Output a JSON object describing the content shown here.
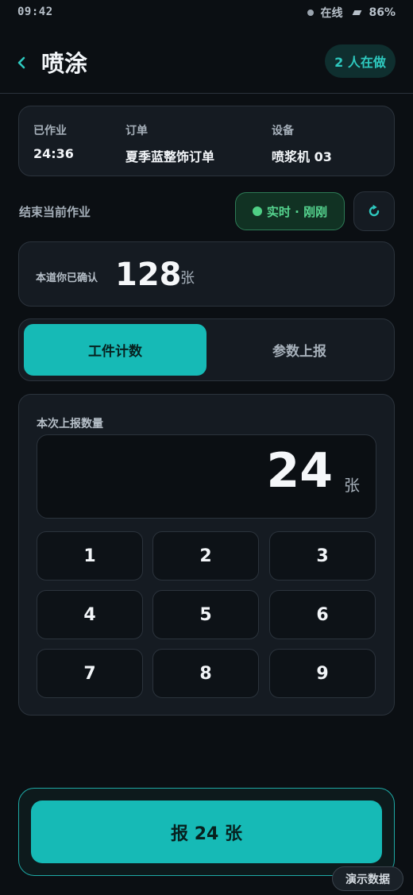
{
  "status_bar": {
    "time": "09:42",
    "network": "在线",
    "battery": "86%"
  },
  "header": {
    "title": "喷涂",
    "online_badge": "2 人在做"
  },
  "info": {
    "elapsed_label": "已作业",
    "elapsed_value": "24:36",
    "order_label": "订单",
    "order_value": "夏季蓝整饰订单",
    "device_label": "设备",
    "device_value": "喷浆机 03"
  },
  "actions": {
    "end_label": "结束当前作业",
    "live_label": "实时 · 刚刚"
  },
  "confirmed": {
    "label": "本道你已确认",
    "value": "128",
    "unit": "张"
  },
  "tabs": [
    {
      "label": "工件计数",
      "active": true
    },
    {
      "label": "参数上报",
      "active": false
    }
  ],
  "report": {
    "label": "本次上报数量",
    "quantity": "24",
    "unit": "张",
    "keys": [
      "1",
      "2",
      "3",
      "4",
      "5",
      "6",
      "7",
      "8",
      "9"
    ]
  },
  "submit": {
    "label": "报 24 张"
  },
  "demo_badge": "演示数据",
  "colors": {
    "accent": "#16bab6",
    "live": "#4fcf85",
    "background": "#0b0f13"
  },
  "icons": [
    "chevron-left-icon",
    "refresh-icon",
    "status-dot-icon",
    "battery-icon",
    "live-dot-icon"
  ]
}
